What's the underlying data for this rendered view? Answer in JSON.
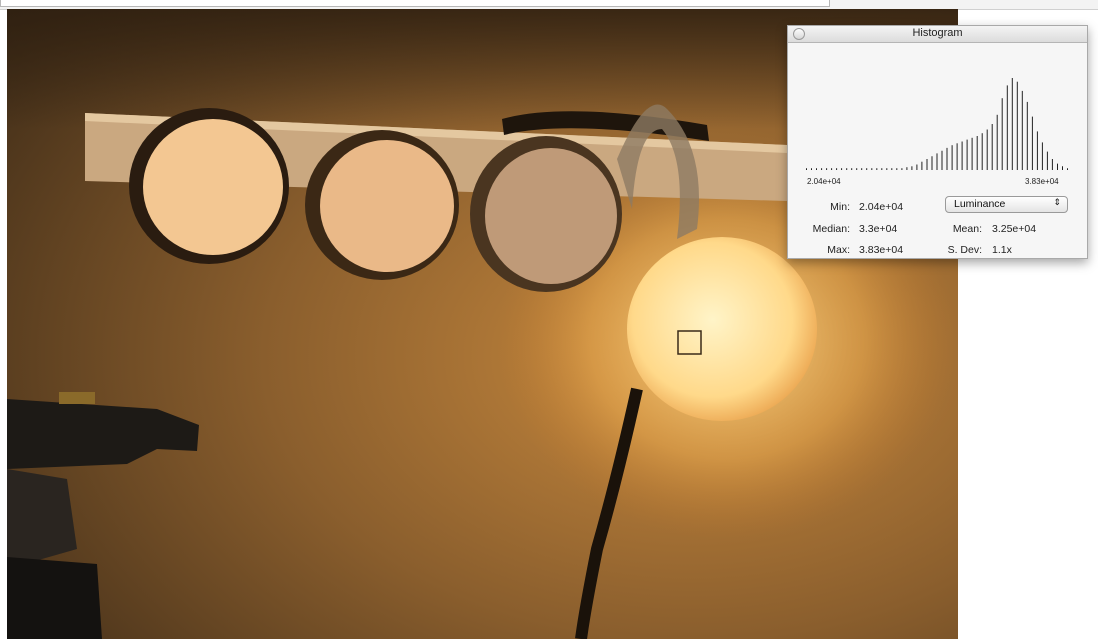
{
  "histogram_window": {
    "title": "Histogram",
    "axis_min_label": "2.04e+04",
    "axis_max_label": "3.83e+04",
    "channel_select": {
      "value": "Luminance",
      "arrows": "⇕"
    },
    "stats": {
      "min_label": "Min:",
      "min_value": "2.04e+04",
      "median_label": "Median:",
      "median_value": "3.3e+04",
      "max_label": "Max:",
      "max_value": "3.83e+04",
      "mean_label": "Mean:",
      "mean_value": "3.25e+04",
      "sdev_label": "S. Dev:",
      "sdev_value": "1.1x"
    },
    "bars": [
      0.02,
      0.02,
      0.02,
      0.02,
      0.02,
      0.02,
      0.02,
      0.02,
      0.02,
      0.02,
      0.02,
      0.02,
      0.02,
      0.02,
      0.02,
      0.02,
      0.02,
      0.02,
      0.02,
      0.02,
      0.03,
      0.04,
      0.06,
      0.09,
      0.12,
      0.15,
      0.18,
      0.21,
      0.24,
      0.27,
      0.29,
      0.31,
      0.33,
      0.35,
      0.37,
      0.4,
      0.44,
      0.5,
      0.6,
      0.78,
      0.92,
      1.0,
      0.96,
      0.86,
      0.74,
      0.58,
      0.42,
      0.3,
      0.2,
      0.12,
      0.07,
      0.04,
      0.02
    ]
  },
  "image_view": {
    "selection_marker": "selection-square"
  }
}
